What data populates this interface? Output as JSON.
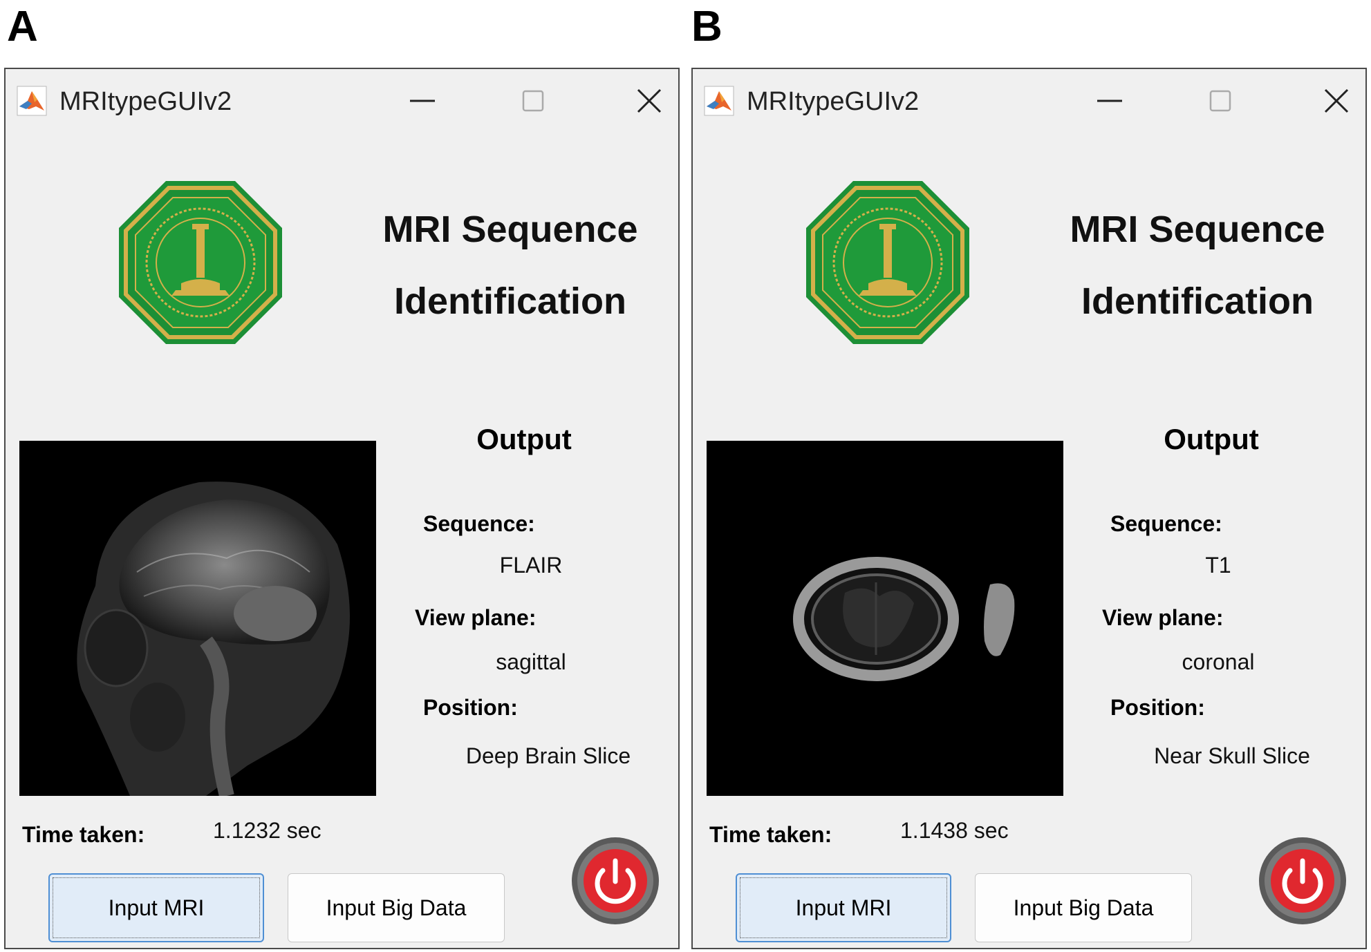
{
  "panels": [
    {
      "letter": "A",
      "window": {
        "title": "MRItypeGUIv2"
      },
      "heading_line1": "MRI Sequence",
      "heading_line2": "Identification",
      "output_label": "Output",
      "sequence_label": "Sequence:",
      "sequence_value": "FLAIR",
      "view_plane_label": "View plane:",
      "view_plane_value": "sagittal",
      "position_label": "Position:",
      "position_value": "Deep Brain Slice",
      "time_label": "Time taken:",
      "time_value": "1.1232 sec",
      "buttons": {
        "input_mri": "Input MRI",
        "input_big_data": "Input Big Data"
      }
    },
    {
      "letter": "B",
      "window": {
        "title": "MRItypeGUIv2"
      },
      "heading_line1": "MRI Sequence",
      "heading_line2": "Identification",
      "output_label": "Output",
      "sequence_label": "Sequence:",
      "sequence_value": "T1",
      "view_plane_label": "View plane:",
      "view_plane_value": "coronal",
      "position_label": "Position:",
      "position_value": "Near Skull Slice",
      "time_label": "Time taken:",
      "time_value": "1.1438 sec",
      "buttons": {
        "input_mri": "Input MRI",
        "input_big_data": "Input Big Data"
      }
    }
  ],
  "icons": {
    "app": "matlab-logo-icon",
    "minimize": "minimize-icon",
    "maximize": "maximize-icon",
    "close": "close-icon",
    "logo": "university-seal-logo",
    "power": "power-icon"
  },
  "colors": {
    "window_bg": "#f0f0f0",
    "seal_green": "#1f9a3a",
    "seal_gold": "#d4b04a",
    "power_red": "#e0282f",
    "primary_button_bg": "#e1ecf8",
    "primary_button_border": "#4f8fd4"
  }
}
